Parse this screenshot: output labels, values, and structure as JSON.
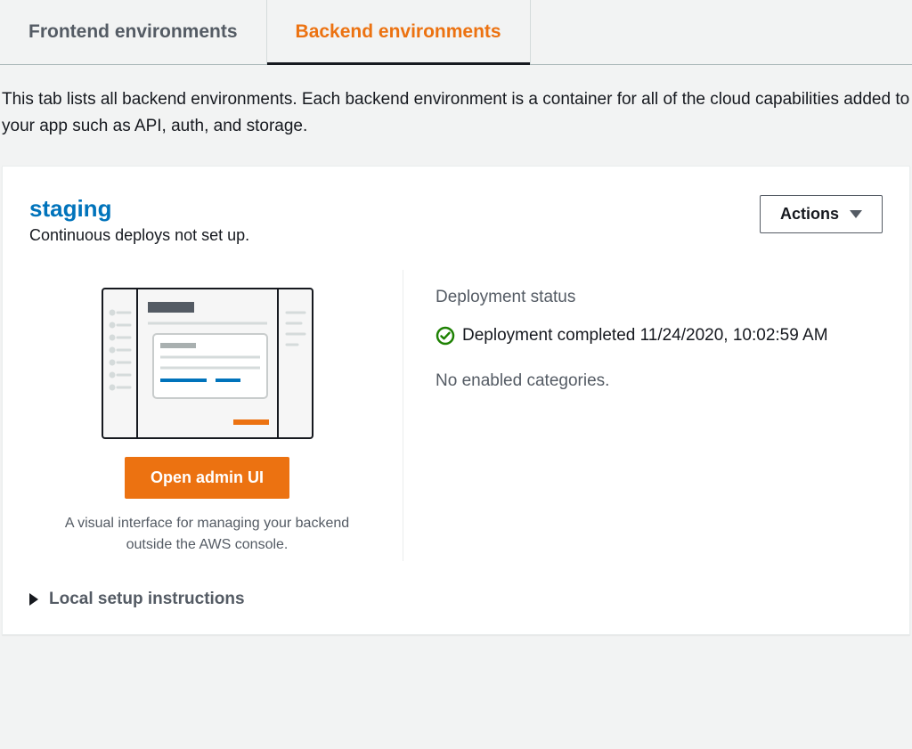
{
  "tabs": {
    "frontend": "Frontend environments",
    "backend": "Backend environments"
  },
  "description": "This tab lists all backend environments. Each backend environment is a container for all of the cloud capabilities added to your app such as API, auth, and storage.",
  "env": {
    "name": "staging",
    "deploys_status": "Continuous deploys not set up.",
    "actions_label": "Actions",
    "open_admin_label": "Open admin UI",
    "admin_description": "A visual interface for managing your backend outside the AWS console.",
    "deployment_heading": "Deployment status",
    "deployment_status": "Deployment completed 11/24/2020, 10:02:59 AM",
    "categories": "No enabled categories.",
    "local_setup_label": "Local setup instructions"
  }
}
